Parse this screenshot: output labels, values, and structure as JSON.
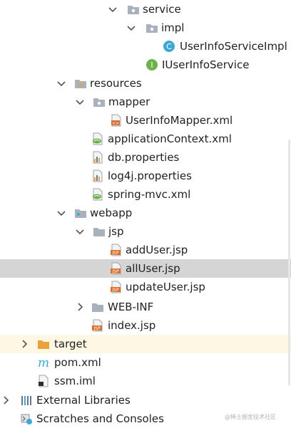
{
  "tree": {
    "items": [
      {
        "label": "service"
      },
      {
        "label": "impl"
      },
      {
        "label": "UserInfoServiceImpl"
      },
      {
        "label": "IUserInfoService"
      },
      {
        "label": "resources"
      },
      {
        "label": "mapper"
      },
      {
        "label": "UserInfoMapper.xml"
      },
      {
        "label": "applicationContext.xml"
      },
      {
        "label": "db.properties"
      },
      {
        "label": "log4j.properties"
      },
      {
        "label": "spring-mvc.xml"
      },
      {
        "label": "webapp"
      },
      {
        "label": "jsp"
      },
      {
        "label": "addUser.jsp"
      },
      {
        "label": "allUser.jsp"
      },
      {
        "label": "updateUser.jsp"
      },
      {
        "label": "WEB-INF"
      },
      {
        "label": "index.jsp"
      },
      {
        "label": "target"
      },
      {
        "label": "pom.xml"
      },
      {
        "label": "ssm.iml"
      },
      {
        "label": "External Libraries"
      },
      {
        "label": "Scratches and Consoles"
      }
    ],
    "icon_text": {
      "class": "C",
      "interface": "I",
      "jsp": "JSP",
      "xml": "<>",
      "maven": "m"
    },
    "watermark": "@稀土掘金技术社区"
  },
  "colors": {
    "selected_row": "#d5d5d5",
    "excluded_row": "#fdf7e3",
    "folder_grey": "#a9b2bc",
    "folder_orange": "#e8a33b",
    "class_icon": "#3fa7d6",
    "interface_icon": "#6cb24a",
    "jsp_icon": "#d9702c"
  }
}
